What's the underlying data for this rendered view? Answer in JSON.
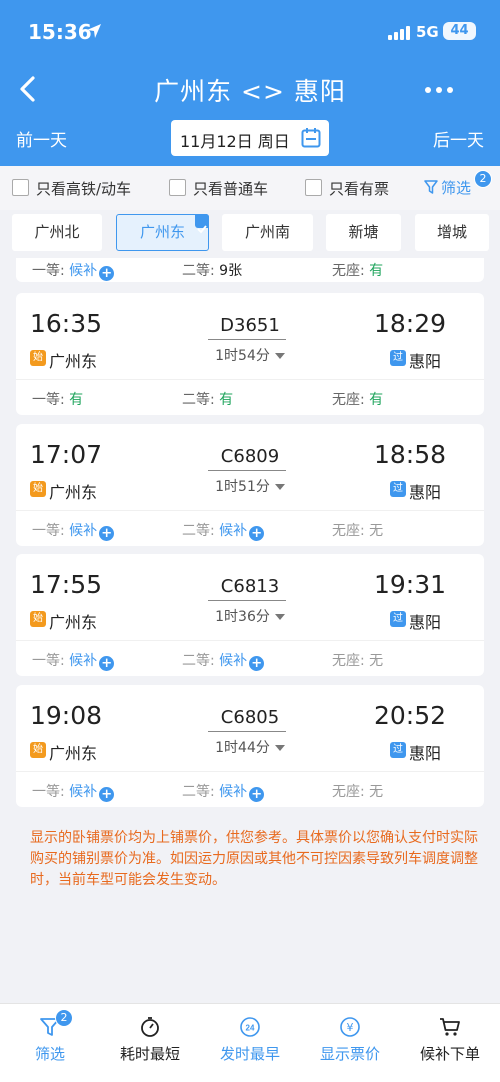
{
  "status_bar": {
    "time": "15:36",
    "network": "5G",
    "battery": "44"
  },
  "nav": {
    "title": "广州东 <> 惠阳"
  },
  "date_bar": {
    "prev_label": "前一天",
    "date_label": "11月12日 周日",
    "next_label": "后一天"
  },
  "filters": {
    "items": [
      {
        "label": "只看高铁/动车",
        "checked": false
      },
      {
        "label": "只看普通车",
        "checked": false
      },
      {
        "label": "只看有票",
        "checked": false
      }
    ],
    "filter_label": "筛选",
    "filter_badge": "2"
  },
  "stations": [
    {
      "label": "广州北",
      "active": false
    },
    {
      "label": "广州东",
      "active": true
    },
    {
      "label": "广州南",
      "active": false
    },
    {
      "label": "新塘",
      "active": false
    },
    {
      "label": "增城",
      "active": false
    }
  ],
  "partial_card": {
    "seats": [
      {
        "label": "一等:",
        "value": "候补",
        "plus": true
      },
      {
        "label": "二等:",
        "value": "9张",
        "plus": false
      },
      {
        "label": "无座:",
        "value": "有",
        "plus": false
      }
    ]
  },
  "trains": [
    {
      "dep_time": "16:35",
      "train_no": "D3651",
      "duration": "1时54分",
      "arr_time": "18:29",
      "dep_station": "广州东",
      "arr_station": "惠阳",
      "start_badge": "始",
      "pass_badge": "过",
      "seats": [
        {
          "label": "一等:",
          "value": "有",
          "plus": false
        },
        {
          "label": "二等:",
          "value": "有",
          "plus": false
        },
        {
          "label": "无座:",
          "value": "有",
          "plus": false
        }
      ]
    },
    {
      "dep_time": "17:07",
      "train_no": "C6809",
      "duration": "1时51分",
      "arr_time": "18:58",
      "dep_station": "广州东",
      "arr_station": "惠阳",
      "start_badge": "始",
      "pass_badge": "过",
      "seats": [
        {
          "label": "一等:",
          "value": "候补",
          "plus": true
        },
        {
          "label": "二等:",
          "value": "候补",
          "plus": true
        },
        {
          "label": "无座:",
          "value": "无",
          "plus": false
        }
      ]
    },
    {
      "dep_time": "17:55",
      "train_no": "C6813",
      "duration": "1时36分",
      "arr_time": "19:31",
      "dep_station": "广州东",
      "arr_station": "惠阳",
      "start_badge": "始",
      "pass_badge": "过",
      "seats": [
        {
          "label": "一等:",
          "value": "候补",
          "plus": true
        },
        {
          "label": "二等:",
          "value": "候补",
          "plus": true
        },
        {
          "label": "无座:",
          "value": "无",
          "plus": false
        }
      ]
    },
    {
      "dep_time": "19:08",
      "train_no": "C6805",
      "duration": "1时44分",
      "arr_time": "20:52",
      "dep_station": "广州东",
      "arr_station": "惠阳",
      "start_badge": "始",
      "pass_badge": "过",
      "seats": [
        {
          "label": "一等:",
          "value": "候补",
          "plus": true
        },
        {
          "label": "二等:",
          "value": "候补",
          "plus": true
        },
        {
          "label": "无座:",
          "value": "无",
          "plus": false
        }
      ]
    }
  ],
  "notice": "显示的卧铺票价均为上铺票价，供您参考。具体票价以您确认支付时实际购买的铺别票价为准。如因运力原因或其他不可控因素导致列车调度调整时，当前车型可能会发生变动。",
  "toolbar": {
    "filter_label": "筛选",
    "filter_badge": "2",
    "shortest_label": "耗时最短",
    "earliest_label": "发时最早",
    "earliest_icon_text": "24",
    "price_label": "显示票价",
    "price_icon_text": "¥",
    "waitlist_label": "候补下单"
  },
  "colors": {
    "primary": "#3f97ee",
    "start_badge": "#f39a1e",
    "available": "#21a55e",
    "notice": "#e86a1f"
  }
}
